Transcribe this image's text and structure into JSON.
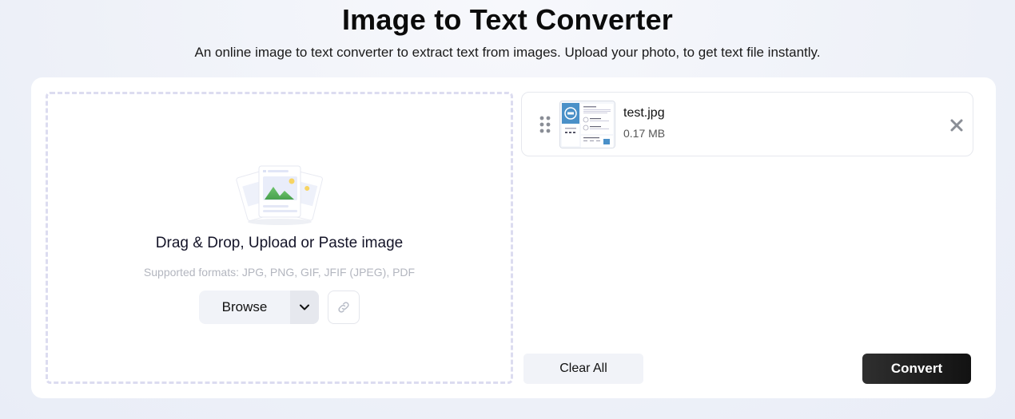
{
  "header": {
    "title": "Image to Text Converter",
    "subtitle": "An online image to text converter to extract text from images. Upload your photo, to get text file instantly."
  },
  "dropzone": {
    "illustration_icon": "image-stack-icon",
    "title": "Drag & Drop, Upload or Paste image",
    "formats": "Supported formats: JPG, PNG, GIF, JFIF (JPEG), PDF",
    "browse_label": "Browse",
    "browse_dropdown_icon": "chevron-down-icon",
    "url_icon": "link-icon"
  },
  "files": [
    {
      "name": "test.jpg",
      "size": "0.17 MB",
      "drag_icon": "drag-handle-icon",
      "remove_icon": "close-icon"
    }
  ],
  "actions": {
    "clear_label": "Clear All",
    "convert_label": "Convert"
  },
  "colors": {
    "primary_button": "#1e1e1e",
    "secondary_button": "#f1f3f8",
    "dashed_border": "#dcdcf0",
    "illustration_green": "#5cb85c"
  }
}
